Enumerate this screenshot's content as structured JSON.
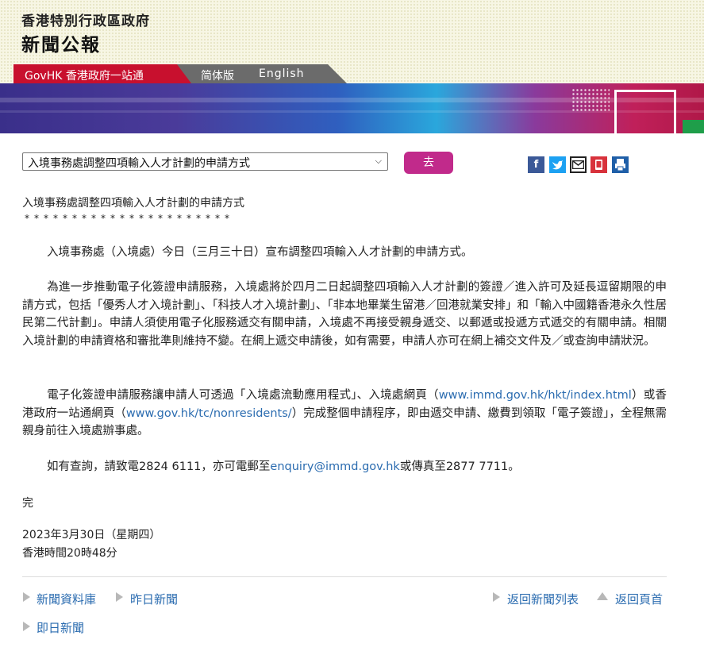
{
  "header": {
    "government_name": "香港特別行政區政府",
    "site_title": "新聞公報"
  },
  "langbar": {
    "govhk_label": "GovHK 香港政府一站通",
    "simplified_label": "简体版",
    "english_label": "English"
  },
  "selector": {
    "selected": "入境事務處調整四項輸入人才計劃的申請方式",
    "go_label": "去"
  },
  "share_icons": [
    "facebook-icon",
    "twitter-icon",
    "email-icon",
    "mobile-icon",
    "print-icon"
  ],
  "article": {
    "title": "入境事務處調整四項輸入人才計劃的申請方式",
    "stars": "**********************",
    "p1": "入境事務處（入境處）今日（三月三十日）宣布調整四項輸入人才計劃的申請方式。",
    "p2": "為進一步推動電子化簽證申請服務，入境處將於四月二日起調整四項輸入人才計劃的簽證／進入許可及延長逗留期限的申請方式，包括「優秀人才入境計劃」、「科技人才入境計劃」、「非本地畢業生留港／回港就業安排」和「輸入中國籍香港永久性居民第二代計劃」。申請人須使用電子化服務遞交有關申請，入境處不再接受親身遞交、以郵遞或投遞方式遞交的有關申請。相關入境計劃的申請資格和審批準則維持不變。在網上遞交申請後，如有需要，申請人亦可在網上補交文件及／或查詢申請狀況。",
    "p3_a": "電子化簽證申請服務讓申請人可透過「入境處流動應用程式」、入境處網頁（",
    "p3_link1": "www.immd.gov.hk/hkt/index.html",
    "p3_b": "）或香港政府一站通網頁（",
    "p3_link2": "www.gov.hk/tc/nonresidents/",
    "p3_c": "）完成整個申請程序，即由遞交申請、繳費到領取「電子簽證」，全程無需親身前往入境處辦事處。",
    "p4_a": "如有查詢，請致電2824 6111，亦可電郵至",
    "p4_email": "enquiry@immd.gov.hk",
    "p4_b": "或傳真至2877 7711。",
    "end_mark": "完",
    "date": "2023年3月30日（星期四）",
    "time": "香港時間20時48分"
  },
  "footer_nav": {
    "archive": "新聞資料庫",
    "yesterday": "昨日新聞",
    "back_to_list": "返回新聞列表",
    "back_to_top": "返回頁首",
    "today": "即日新聞"
  },
  "colors": {
    "govhk_red": "#c8102e",
    "go_button": "#c12a8b",
    "link_blue": "#2b6cb0"
  }
}
